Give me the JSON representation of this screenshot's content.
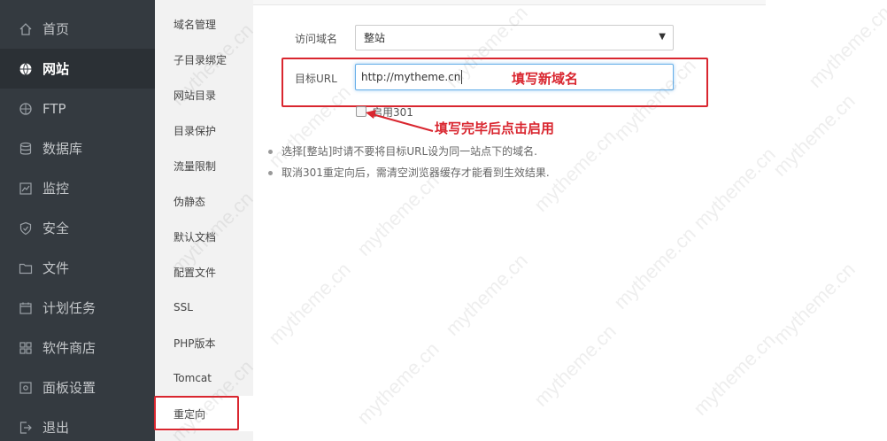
{
  "sidebar": {
    "items": [
      {
        "label": "首页",
        "icon": "home-icon"
      },
      {
        "label": "网站",
        "icon": "globe-icon",
        "active": true
      },
      {
        "label": "FTP",
        "icon": "ftp-icon"
      },
      {
        "label": "数据库",
        "icon": "database-icon"
      },
      {
        "label": "监控",
        "icon": "monitor-icon"
      },
      {
        "label": "安全",
        "icon": "shield-icon"
      },
      {
        "label": "文件",
        "icon": "folder-icon"
      },
      {
        "label": "计划任务",
        "icon": "calendar-icon"
      },
      {
        "label": "软件商店",
        "icon": "apps-icon"
      },
      {
        "label": "面板设置",
        "icon": "settings-icon"
      },
      {
        "label": "退出",
        "icon": "logout-icon"
      }
    ]
  },
  "submenu": {
    "items": [
      {
        "label": "域名管理"
      },
      {
        "label": "子目录绑定"
      },
      {
        "label": "网站目录"
      },
      {
        "label": "目录保护"
      },
      {
        "label": "流量限制"
      },
      {
        "label": "伪静态"
      },
      {
        "label": "默认文档"
      },
      {
        "label": "配置文件"
      },
      {
        "label": "SSL"
      },
      {
        "label": "PHP版本"
      },
      {
        "label": "Tomcat"
      },
      {
        "label": "重定向",
        "active": true
      }
    ]
  },
  "form": {
    "domain_label": "访问域名",
    "domain_value": "整站",
    "target_label": "目标URL",
    "target_value": "http://mytheme.cn",
    "enable_label": "启用301"
  },
  "annotations": {
    "fill_new_domain": "填写新域名",
    "click_enable": "填写完毕后点击启用"
  },
  "tips": [
    "选择[整站]时请不要将目标URL设为同一站点下的域名.",
    "取消301重定向后，需清空浏览器缓存才能看到生效结果."
  ],
  "watermark": "mytheme.cn",
  "colors": {
    "sidebar_bg": "#343a40",
    "annotation_red": "#d9262f",
    "input_focus": "#66afe9"
  }
}
